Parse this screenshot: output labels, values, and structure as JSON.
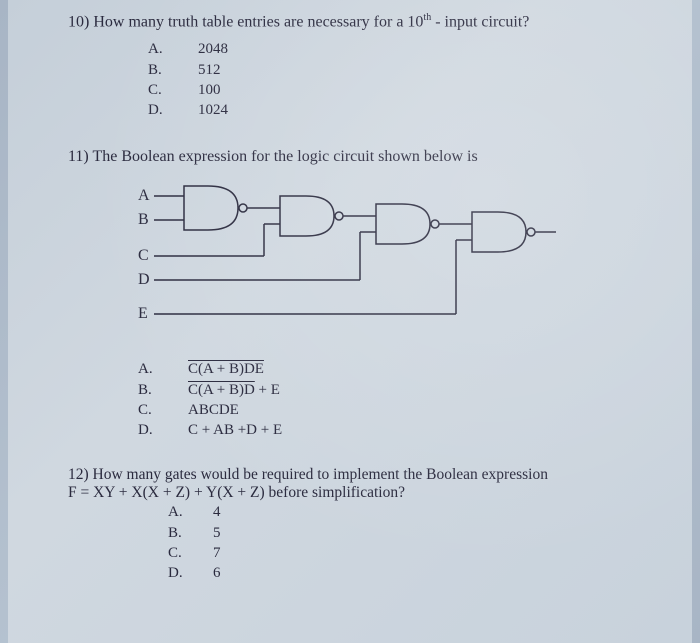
{
  "q10": {
    "number": "10)",
    "prompt_prefix": "How many truth table entries are necessary for a 10",
    "prompt_sup": "th",
    "prompt_suffix": " - input circuit?",
    "choices": [
      {
        "letter": "A.",
        "value": "2048"
      },
      {
        "letter": "B.",
        "value": "512"
      },
      {
        "letter": "C.",
        "value": "100"
      },
      {
        "letter": "D.",
        "value": "1024"
      }
    ]
  },
  "q11": {
    "number": "11)",
    "prompt": "The Boolean expression for the logic circuit shown below is",
    "inputs": {
      "a": "A",
      "b": "B",
      "c": "C",
      "d": "D",
      "e": "E"
    },
    "choices": [
      {
        "letter": "A.",
        "over": "C(A + B)DE",
        "rest": ""
      },
      {
        "letter": "B.",
        "over": "C(A + B)D",
        "rest": " + E"
      },
      {
        "letter": "C.",
        "over": "",
        "rest": "ABCDE"
      },
      {
        "letter": "D.",
        "over": "",
        "rest": "C + AB +D + E"
      }
    ]
  },
  "q12": {
    "number": "12)",
    "prompt_line1": "How many gates would be required to implement the Boolean expression",
    "prompt_line2": "F = XY + X(X + Z) + Y(X + Z) before simplification?",
    "choices": [
      {
        "letter": "A.",
        "value": "4"
      },
      {
        "letter": "B.",
        "value": "5"
      },
      {
        "letter": "C.",
        "value": "7"
      },
      {
        "letter": "D.",
        "value": "6"
      }
    ]
  }
}
